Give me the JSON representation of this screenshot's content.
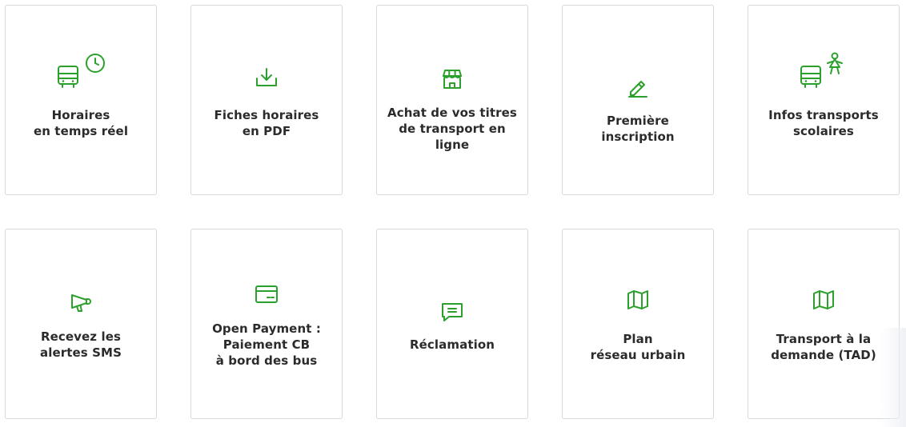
{
  "colors": {
    "accent": "#2ca02c",
    "text": "#2b2b2b",
    "border": "#d9d9d9"
  },
  "cards": [
    {
      "label": "Horaires\nen temps réel",
      "icon": "bus-clock-icon"
    },
    {
      "label": "Fiches horaires\nen PDF",
      "icon": "download-icon"
    },
    {
      "label": "Achat de vos titres\nde transport en ligne",
      "icon": "shop-icon"
    },
    {
      "label": "Première inscription",
      "icon": "pencil-icon"
    },
    {
      "label": "Infos transports\nscolaires",
      "icon": "bus-child-icon"
    },
    {
      "label": "Recevez les\nalertes SMS",
      "icon": "megaphone-icon"
    },
    {
      "label": "Open Payment :\nPaiement CB\nà bord des bus",
      "icon": "credit-card-icon"
    },
    {
      "label": "Réclamation",
      "icon": "message-icon"
    },
    {
      "label": "Plan\nréseau urbain",
      "icon": "map-icon"
    },
    {
      "label": "Transport à la\ndemande (TAD)",
      "icon": "map-icon"
    }
  ]
}
